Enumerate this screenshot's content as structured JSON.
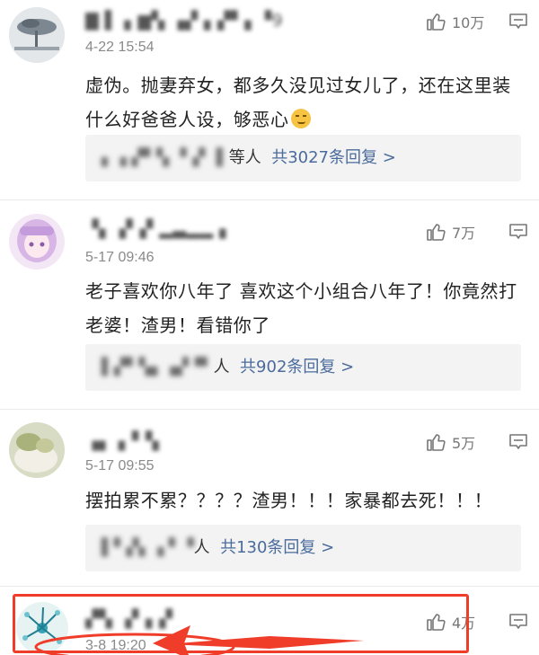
{
  "comments": [
    {
      "username_masked": "▇ ▌ ▖▆▚ ▗▞ ▖▞▘▖▝9",
      "timestamp": "4-22 15:54",
      "text": "虚伪。抛妻弃女，都多久没见过女儿了，还在这里装什么好爸爸人设，够恶心",
      "emoji": "smirk-emoji",
      "likes": "10万",
      "reply_names_masked": "▖▗ ▞▘▚ ▝▗▘ ▌",
      "reply_suffix": "等人",
      "reply_count": "共3027条回复 >"
    },
    {
      "username_masked": "▝▖▗▘▞ ▂▃▂▂ ▖",
      "timestamp": "5-17 09:46",
      "text": "老子喜欢你八年了 喜欢这个小组合八年了！你竟然打老婆！渣男！看错你了",
      "likes": "7万",
      "reply_names_masked": "▌▞▘▚▖▗▞▝▘",
      "reply_suffix": "人",
      "reply_count": "共902条回复 >"
    },
    {
      "username_masked": "▗▖ ▖▘▚",
      "timestamp": "5-17 09:55",
      "text": "摆拍累不累？？？？渣男！！！家暴都去死！！！",
      "likes": "5万",
      "reply_names_masked": "▌▘▞▖▗ ▘▝",
      "reply_suffix": "人",
      "reply_count": "共130条回复 >"
    },
    {
      "username_masked": "▞▚ ▗▘▖▞",
      "timestamp": "3-8 19:20",
      "likes": "4万"
    }
  ],
  "colors": {
    "highlight": "#ef3d2a",
    "reply_link": "#4a6b9c",
    "reply_bg": "#f3f3f3"
  }
}
